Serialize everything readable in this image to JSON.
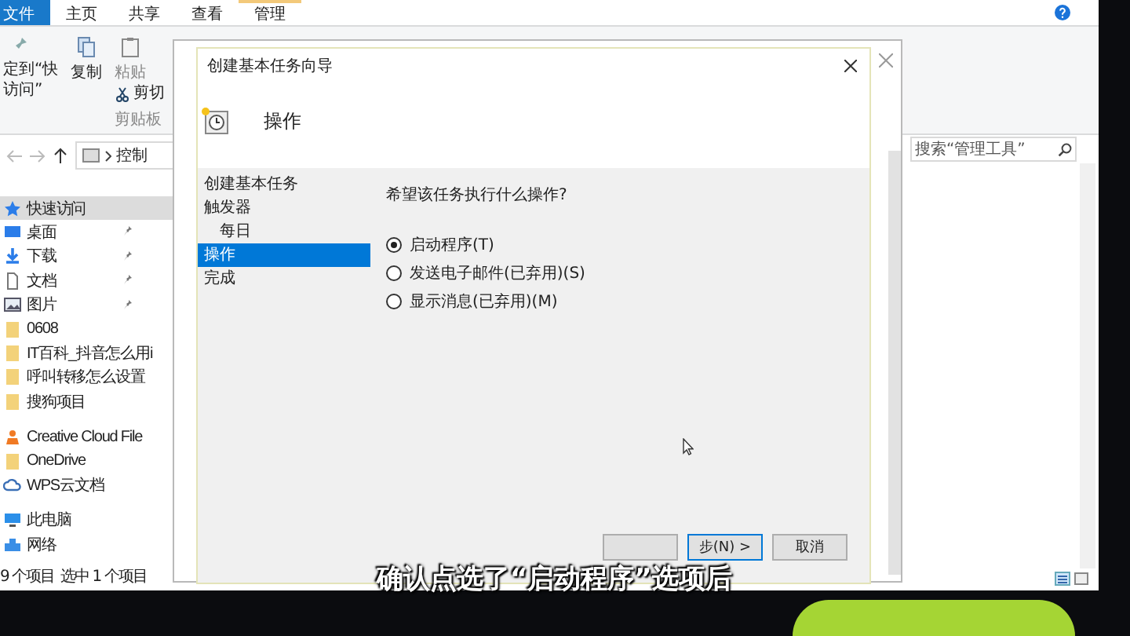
{
  "explorer": {
    "ribbon_tabs": [
      {
        "label": "文件",
        "selected": true
      },
      {
        "label": "主页",
        "selected": false
      },
      {
        "label": "共享",
        "selected": false
      },
      {
        "label": "查看",
        "selected": false
      },
      {
        "label": "管理",
        "selected": false
      }
    ],
    "ribbon": {
      "pin_label": [
        "定到“快",
        "访问”"
      ],
      "copy": "复制",
      "paste": "粘贴",
      "cut": "剪切",
      "group": "剪贴板"
    },
    "address": "控制",
    "search": {
      "placeholder": "搜索“管理工具”"
    },
    "nav": [
      {
        "label": "快速访问",
        "kind": "star",
        "selected": true,
        "pinned": false
      },
      {
        "label": "桌面",
        "kind": "desktop",
        "selected": false,
        "pinned": true
      },
      {
        "label": "下载",
        "kind": "download",
        "selected": false,
        "pinned": true
      },
      {
        "label": "文档",
        "kind": "document",
        "selected": false,
        "pinned": true
      },
      {
        "label": "图片",
        "kind": "picture",
        "selected": false,
        "pinned": true
      },
      {
        "label": "0608",
        "kind": "folder",
        "selected": false,
        "pinned": false
      },
      {
        "label": "IT百科_抖音怎么用i",
        "kind": "folder",
        "selected": false,
        "pinned": false
      },
      {
        "label": "呼叫转移怎么设置",
        "kind": "folder",
        "selected": false,
        "pinned": false
      },
      {
        "label": "搜狗项目",
        "kind": "folder",
        "selected": false,
        "pinned": false
      },
      {
        "label": "Creative Cloud File",
        "kind": "app",
        "selected": false,
        "pinned": false
      },
      {
        "label": "OneDrive",
        "kind": "folder",
        "selected": false,
        "pinned": false
      },
      {
        "label": "WPS云文档",
        "kind": "cloud",
        "selected": false,
        "pinned": false
      },
      {
        "label": "此电脑",
        "kind": "computer",
        "selected": false,
        "pinned": false
      },
      {
        "label": "网络",
        "kind": "network",
        "selected": false,
        "pinned": false
      }
    ],
    "status": [
      "9 个项目",
      "选中 1 个项目"
    ]
  },
  "dialog": {
    "title": "创建基本任务向导",
    "heading": "操作",
    "steps": [
      {
        "label": "创建基本任务",
        "selected": false
      },
      {
        "label": "触发器",
        "selected": false,
        "children": [
          {
            "label": "每日",
            "selected": false
          }
        ]
      },
      {
        "label": "操作",
        "selected": true
      },
      {
        "label": "完成",
        "selected": false
      }
    ],
    "question": "希望该任务执行什么操作?",
    "options": [
      {
        "label": "启动程序(T)",
        "selected": true
      },
      {
        "label": "发送电子邮件(已弃用)(S)",
        "selected": false
      },
      {
        "label": "显示消息(已弃用)(M)",
        "selected": false
      }
    ],
    "buttons": [
      {
        "kind": "back"
      },
      {
        "label": "步(N) >",
        "kind": "default"
      },
      {
        "label": "取消",
        "kind": "normal"
      }
    ]
  },
  "subtitle": "确认点选了“启动程序”选项后"
}
